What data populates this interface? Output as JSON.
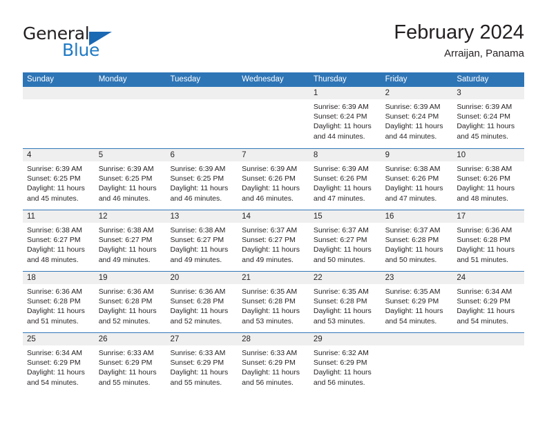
{
  "brand": {
    "name_part1": "General",
    "name_part2": "Blue"
  },
  "header": {
    "title": "February 2024",
    "subtitle": "Arraijan, Panama"
  },
  "colors": {
    "header_blue": "#2e75b6",
    "logo_blue": "#1f7ac4",
    "day_band_gray": "#efefef",
    "text": "#231f20"
  },
  "weekdays": [
    "Sunday",
    "Monday",
    "Tuesday",
    "Wednesday",
    "Thursday",
    "Friday",
    "Saturday"
  ],
  "labels": {
    "sunrise_prefix": "Sunrise:",
    "sunset_prefix": "Sunset:",
    "daylight_prefix": "Daylight:"
  },
  "weeks": [
    [
      {
        "day": "",
        "empty": true
      },
      {
        "day": "",
        "empty": true
      },
      {
        "day": "",
        "empty": true
      },
      {
        "day": "",
        "empty": true
      },
      {
        "day": "1",
        "sunrise": "Sunrise: 6:39 AM",
        "sunset": "Sunset: 6:24 PM",
        "daylight_line1": "Daylight: 11 hours",
        "daylight_line2": "and 44 minutes."
      },
      {
        "day": "2",
        "sunrise": "Sunrise: 6:39 AM",
        "sunset": "Sunset: 6:24 PM",
        "daylight_line1": "Daylight: 11 hours",
        "daylight_line2": "and 44 minutes."
      },
      {
        "day": "3",
        "sunrise": "Sunrise: 6:39 AM",
        "sunset": "Sunset: 6:24 PM",
        "daylight_line1": "Daylight: 11 hours",
        "daylight_line2": "and 45 minutes."
      }
    ],
    [
      {
        "day": "4",
        "sunrise": "Sunrise: 6:39 AM",
        "sunset": "Sunset: 6:25 PM",
        "daylight_line1": "Daylight: 11 hours",
        "daylight_line2": "and 45 minutes."
      },
      {
        "day": "5",
        "sunrise": "Sunrise: 6:39 AM",
        "sunset": "Sunset: 6:25 PM",
        "daylight_line1": "Daylight: 11 hours",
        "daylight_line2": "and 46 minutes."
      },
      {
        "day": "6",
        "sunrise": "Sunrise: 6:39 AM",
        "sunset": "Sunset: 6:25 PM",
        "daylight_line1": "Daylight: 11 hours",
        "daylight_line2": "and 46 minutes."
      },
      {
        "day": "7",
        "sunrise": "Sunrise: 6:39 AM",
        "sunset": "Sunset: 6:26 PM",
        "daylight_line1": "Daylight: 11 hours",
        "daylight_line2": "and 46 minutes."
      },
      {
        "day": "8",
        "sunrise": "Sunrise: 6:39 AM",
        "sunset": "Sunset: 6:26 PM",
        "daylight_line1": "Daylight: 11 hours",
        "daylight_line2": "and 47 minutes."
      },
      {
        "day": "9",
        "sunrise": "Sunrise: 6:38 AM",
        "sunset": "Sunset: 6:26 PM",
        "daylight_line1": "Daylight: 11 hours",
        "daylight_line2": "and 47 minutes."
      },
      {
        "day": "10",
        "sunrise": "Sunrise: 6:38 AM",
        "sunset": "Sunset: 6:26 PM",
        "daylight_line1": "Daylight: 11 hours",
        "daylight_line2": "and 48 minutes."
      }
    ],
    [
      {
        "day": "11",
        "sunrise": "Sunrise: 6:38 AM",
        "sunset": "Sunset: 6:27 PM",
        "daylight_line1": "Daylight: 11 hours",
        "daylight_line2": "and 48 minutes."
      },
      {
        "day": "12",
        "sunrise": "Sunrise: 6:38 AM",
        "sunset": "Sunset: 6:27 PM",
        "daylight_line1": "Daylight: 11 hours",
        "daylight_line2": "and 49 minutes."
      },
      {
        "day": "13",
        "sunrise": "Sunrise: 6:38 AM",
        "sunset": "Sunset: 6:27 PM",
        "daylight_line1": "Daylight: 11 hours",
        "daylight_line2": "and 49 minutes."
      },
      {
        "day": "14",
        "sunrise": "Sunrise: 6:37 AM",
        "sunset": "Sunset: 6:27 PM",
        "daylight_line1": "Daylight: 11 hours",
        "daylight_line2": "and 49 minutes."
      },
      {
        "day": "15",
        "sunrise": "Sunrise: 6:37 AM",
        "sunset": "Sunset: 6:27 PM",
        "daylight_line1": "Daylight: 11 hours",
        "daylight_line2": "and 50 minutes."
      },
      {
        "day": "16",
        "sunrise": "Sunrise: 6:37 AM",
        "sunset": "Sunset: 6:28 PM",
        "daylight_line1": "Daylight: 11 hours",
        "daylight_line2": "and 50 minutes."
      },
      {
        "day": "17",
        "sunrise": "Sunrise: 6:36 AM",
        "sunset": "Sunset: 6:28 PM",
        "daylight_line1": "Daylight: 11 hours",
        "daylight_line2": "and 51 minutes."
      }
    ],
    [
      {
        "day": "18",
        "sunrise": "Sunrise: 6:36 AM",
        "sunset": "Sunset: 6:28 PM",
        "daylight_line1": "Daylight: 11 hours",
        "daylight_line2": "and 51 minutes."
      },
      {
        "day": "19",
        "sunrise": "Sunrise: 6:36 AM",
        "sunset": "Sunset: 6:28 PM",
        "daylight_line1": "Daylight: 11 hours",
        "daylight_line2": "and 52 minutes."
      },
      {
        "day": "20",
        "sunrise": "Sunrise: 6:36 AM",
        "sunset": "Sunset: 6:28 PM",
        "daylight_line1": "Daylight: 11 hours",
        "daylight_line2": "and 52 minutes."
      },
      {
        "day": "21",
        "sunrise": "Sunrise: 6:35 AM",
        "sunset": "Sunset: 6:28 PM",
        "daylight_line1": "Daylight: 11 hours",
        "daylight_line2": "and 53 minutes."
      },
      {
        "day": "22",
        "sunrise": "Sunrise: 6:35 AM",
        "sunset": "Sunset: 6:28 PM",
        "daylight_line1": "Daylight: 11 hours",
        "daylight_line2": "and 53 minutes."
      },
      {
        "day": "23",
        "sunrise": "Sunrise: 6:35 AM",
        "sunset": "Sunset: 6:29 PM",
        "daylight_line1": "Daylight: 11 hours",
        "daylight_line2": "and 54 minutes."
      },
      {
        "day": "24",
        "sunrise": "Sunrise: 6:34 AM",
        "sunset": "Sunset: 6:29 PM",
        "daylight_line1": "Daylight: 11 hours",
        "daylight_line2": "and 54 minutes."
      }
    ],
    [
      {
        "day": "25",
        "sunrise": "Sunrise: 6:34 AM",
        "sunset": "Sunset: 6:29 PM",
        "daylight_line1": "Daylight: 11 hours",
        "daylight_line2": "and 54 minutes."
      },
      {
        "day": "26",
        "sunrise": "Sunrise: 6:33 AM",
        "sunset": "Sunset: 6:29 PM",
        "daylight_line1": "Daylight: 11 hours",
        "daylight_line2": "and 55 minutes."
      },
      {
        "day": "27",
        "sunrise": "Sunrise: 6:33 AM",
        "sunset": "Sunset: 6:29 PM",
        "daylight_line1": "Daylight: 11 hours",
        "daylight_line2": "and 55 minutes."
      },
      {
        "day": "28",
        "sunrise": "Sunrise: 6:33 AM",
        "sunset": "Sunset: 6:29 PM",
        "daylight_line1": "Daylight: 11 hours",
        "daylight_line2": "and 56 minutes."
      },
      {
        "day": "29",
        "sunrise": "Sunrise: 6:32 AM",
        "sunset": "Sunset: 6:29 PM",
        "daylight_line1": "Daylight: 11 hours",
        "daylight_line2": "and 56 minutes."
      },
      {
        "day": "",
        "empty": true
      },
      {
        "day": "",
        "empty": true
      }
    ]
  ]
}
